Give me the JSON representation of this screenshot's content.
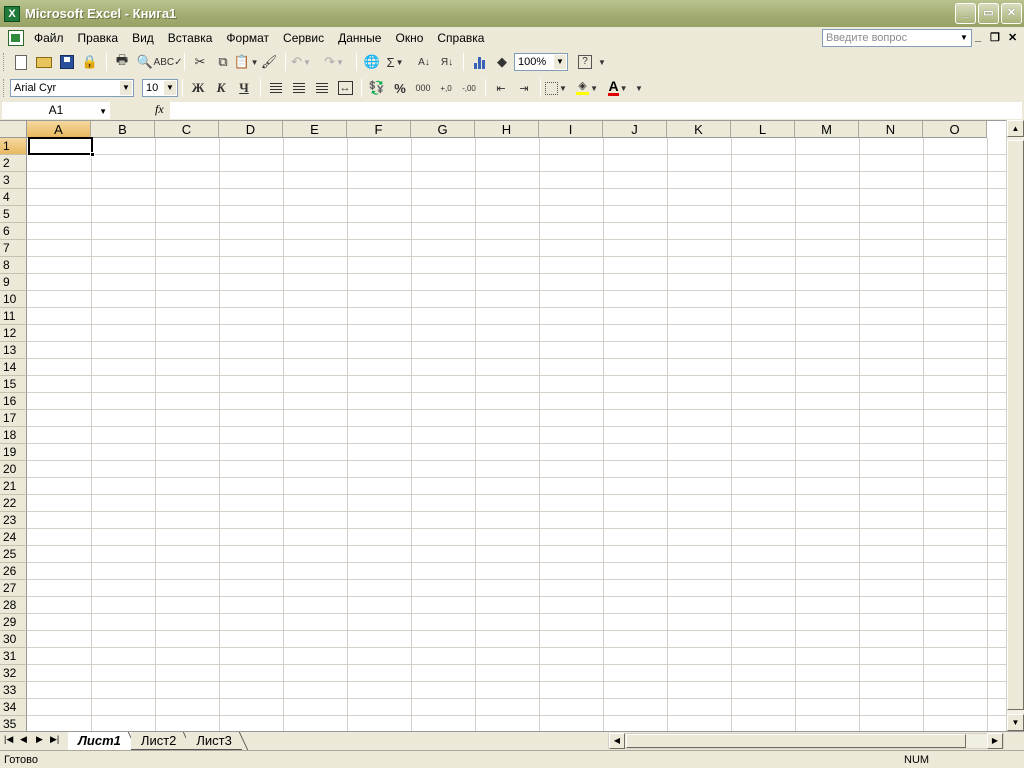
{
  "window": {
    "title": "Microsoft Excel - Книга1",
    "app_icon": "X",
    "minimize": "_",
    "maximize": "▭",
    "close": "✕"
  },
  "menu": {
    "items": [
      "Файл",
      "Правка",
      "Вид",
      "Вставка",
      "Формат",
      "Сервис",
      "Данные",
      "Окно",
      "Справка"
    ],
    "help_placeholder": "Введите вопрос",
    "doc_minimize": "_",
    "doc_restore": "❐",
    "doc_close": "✕"
  },
  "toolbar": {
    "zoom": "100%",
    "sum_symbol": "Σ",
    "font_name": "Arial Cyr",
    "font_size": "10",
    "bold": "Ж",
    "italic": "К",
    "underline": "Ч",
    "percent": "%",
    "thousands": "000",
    "inc_decimal": "+,0",
    "dec_decimal": "-,00",
    "font_color_letter": "A",
    "help_symbol": "?",
    "sort_asc": "A↓",
    "sort_desc": "Я↓"
  },
  "formula_bar": {
    "name_box": "A1",
    "fx": "fx",
    "formula": ""
  },
  "grid": {
    "columns": [
      "A",
      "B",
      "C",
      "D",
      "E",
      "F",
      "G",
      "H",
      "I",
      "J",
      "K",
      "L",
      "M",
      "N",
      "O"
    ],
    "rows": [
      "1",
      "2",
      "3",
      "4",
      "5",
      "6",
      "7",
      "8",
      "9",
      "10",
      "11",
      "12",
      "13",
      "14",
      "15",
      "16",
      "17",
      "18",
      "19",
      "20",
      "21",
      "22",
      "23",
      "24",
      "25",
      "26",
      "27",
      "28",
      "29",
      "30",
      "31",
      "32",
      "33",
      "34",
      "35"
    ],
    "active_column": "A",
    "active_row": "1"
  },
  "sheets": {
    "tabs": [
      "Лист1",
      "Лист2",
      "Лист3"
    ],
    "active": "Лист1",
    "nav": [
      "|◀",
      "◀",
      "▶",
      "▶|"
    ]
  },
  "status": {
    "text": "Готово",
    "num": "NUM"
  }
}
